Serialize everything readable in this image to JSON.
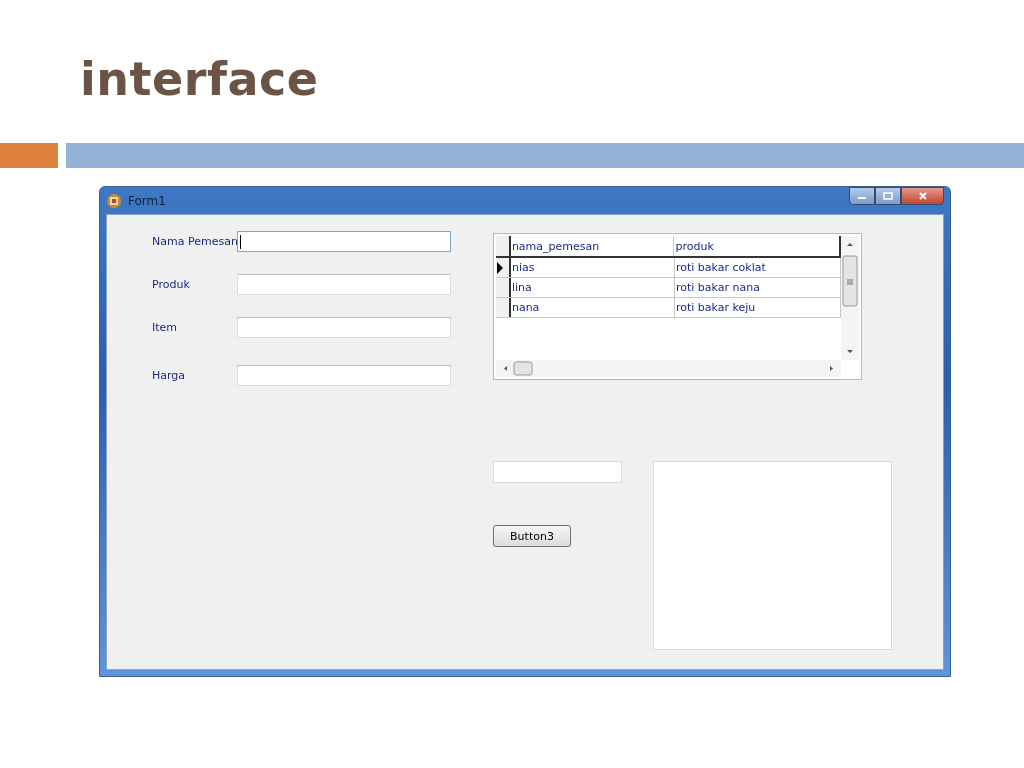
{
  "slide": {
    "title": "interface"
  },
  "window": {
    "title": "Form1"
  },
  "form_fields": [
    {
      "label": "Nama Pemesan",
      "focused": true
    },
    {
      "label": "Produk",
      "focused": false
    },
    {
      "label": "Item",
      "focused": false
    },
    {
      "label": "Harga",
      "focused": false
    }
  ],
  "grid": {
    "columns": [
      "nama_pemesan",
      "produk"
    ],
    "rows": [
      {
        "cells": [
          "nias",
          "roti bakar coklat"
        ],
        "selected": true
      },
      {
        "cells": [
          "lina",
          "roti bakar nana"
        ],
        "selected": false
      },
      {
        "cells": [
          "nana",
          "roti bakar keju"
        ],
        "selected": false
      }
    ]
  },
  "button": {
    "label": "Button3"
  }
}
